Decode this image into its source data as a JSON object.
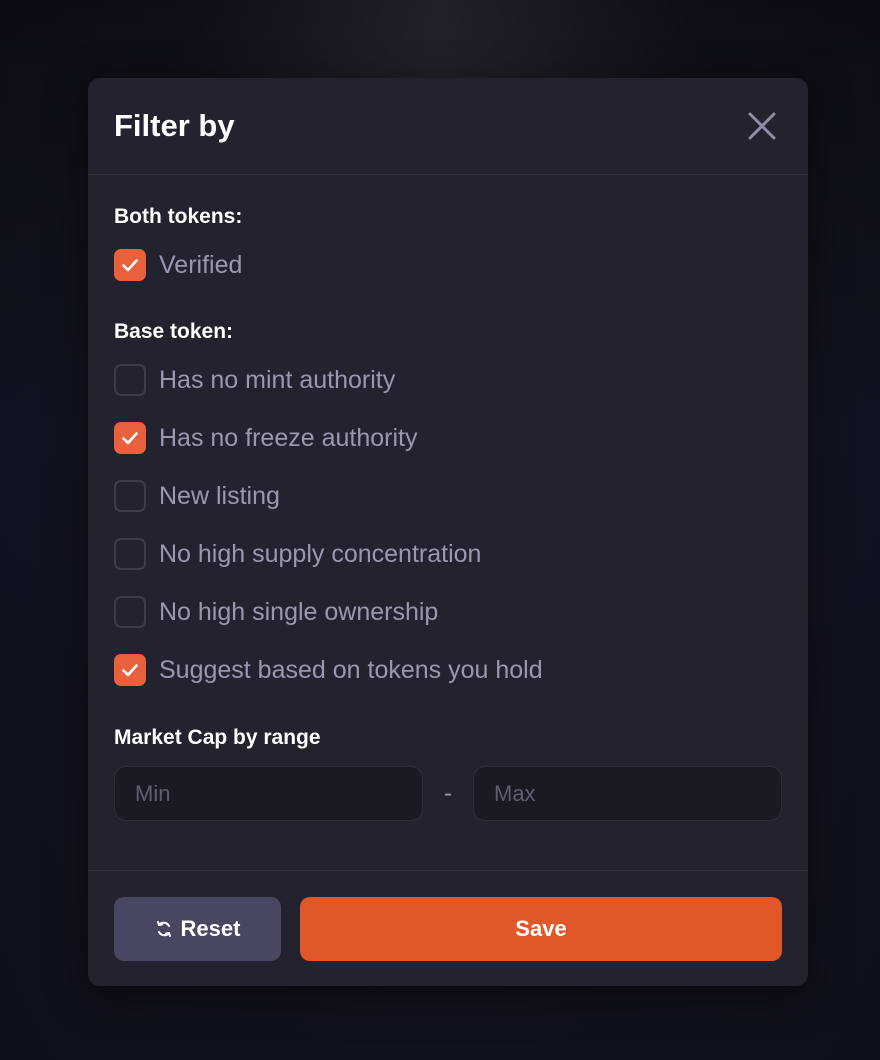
{
  "modal": {
    "title": "Filter by",
    "close_icon": "close-icon"
  },
  "both_tokens": {
    "title": "Both tokens:",
    "items": [
      {
        "label": "Verified",
        "checked": true
      }
    ]
  },
  "base_token": {
    "title": "Base token:",
    "items": [
      {
        "label": "Has no mint authority",
        "checked": false
      },
      {
        "label": "Has no freeze authority",
        "checked": true
      },
      {
        "label": "New listing",
        "checked": false
      },
      {
        "label": "No high supply concentration",
        "checked": false
      },
      {
        "label": "No high single ownership",
        "checked": false
      },
      {
        "label": "Suggest based on tokens you hold",
        "checked": true
      }
    ]
  },
  "market_cap": {
    "title": "Market Cap by range",
    "min_placeholder": "Min",
    "min_value": "",
    "separator": "-",
    "max_placeholder": "Max",
    "max_value": ""
  },
  "footer": {
    "reset_label": "Reset",
    "reset_icon": "refresh-icon",
    "save_label": "Save"
  },
  "colors": {
    "accent": "#e2572a",
    "checkbox_checked": "#e8603c",
    "modal_bg": "#23232f",
    "reset_bg": "#474761"
  }
}
